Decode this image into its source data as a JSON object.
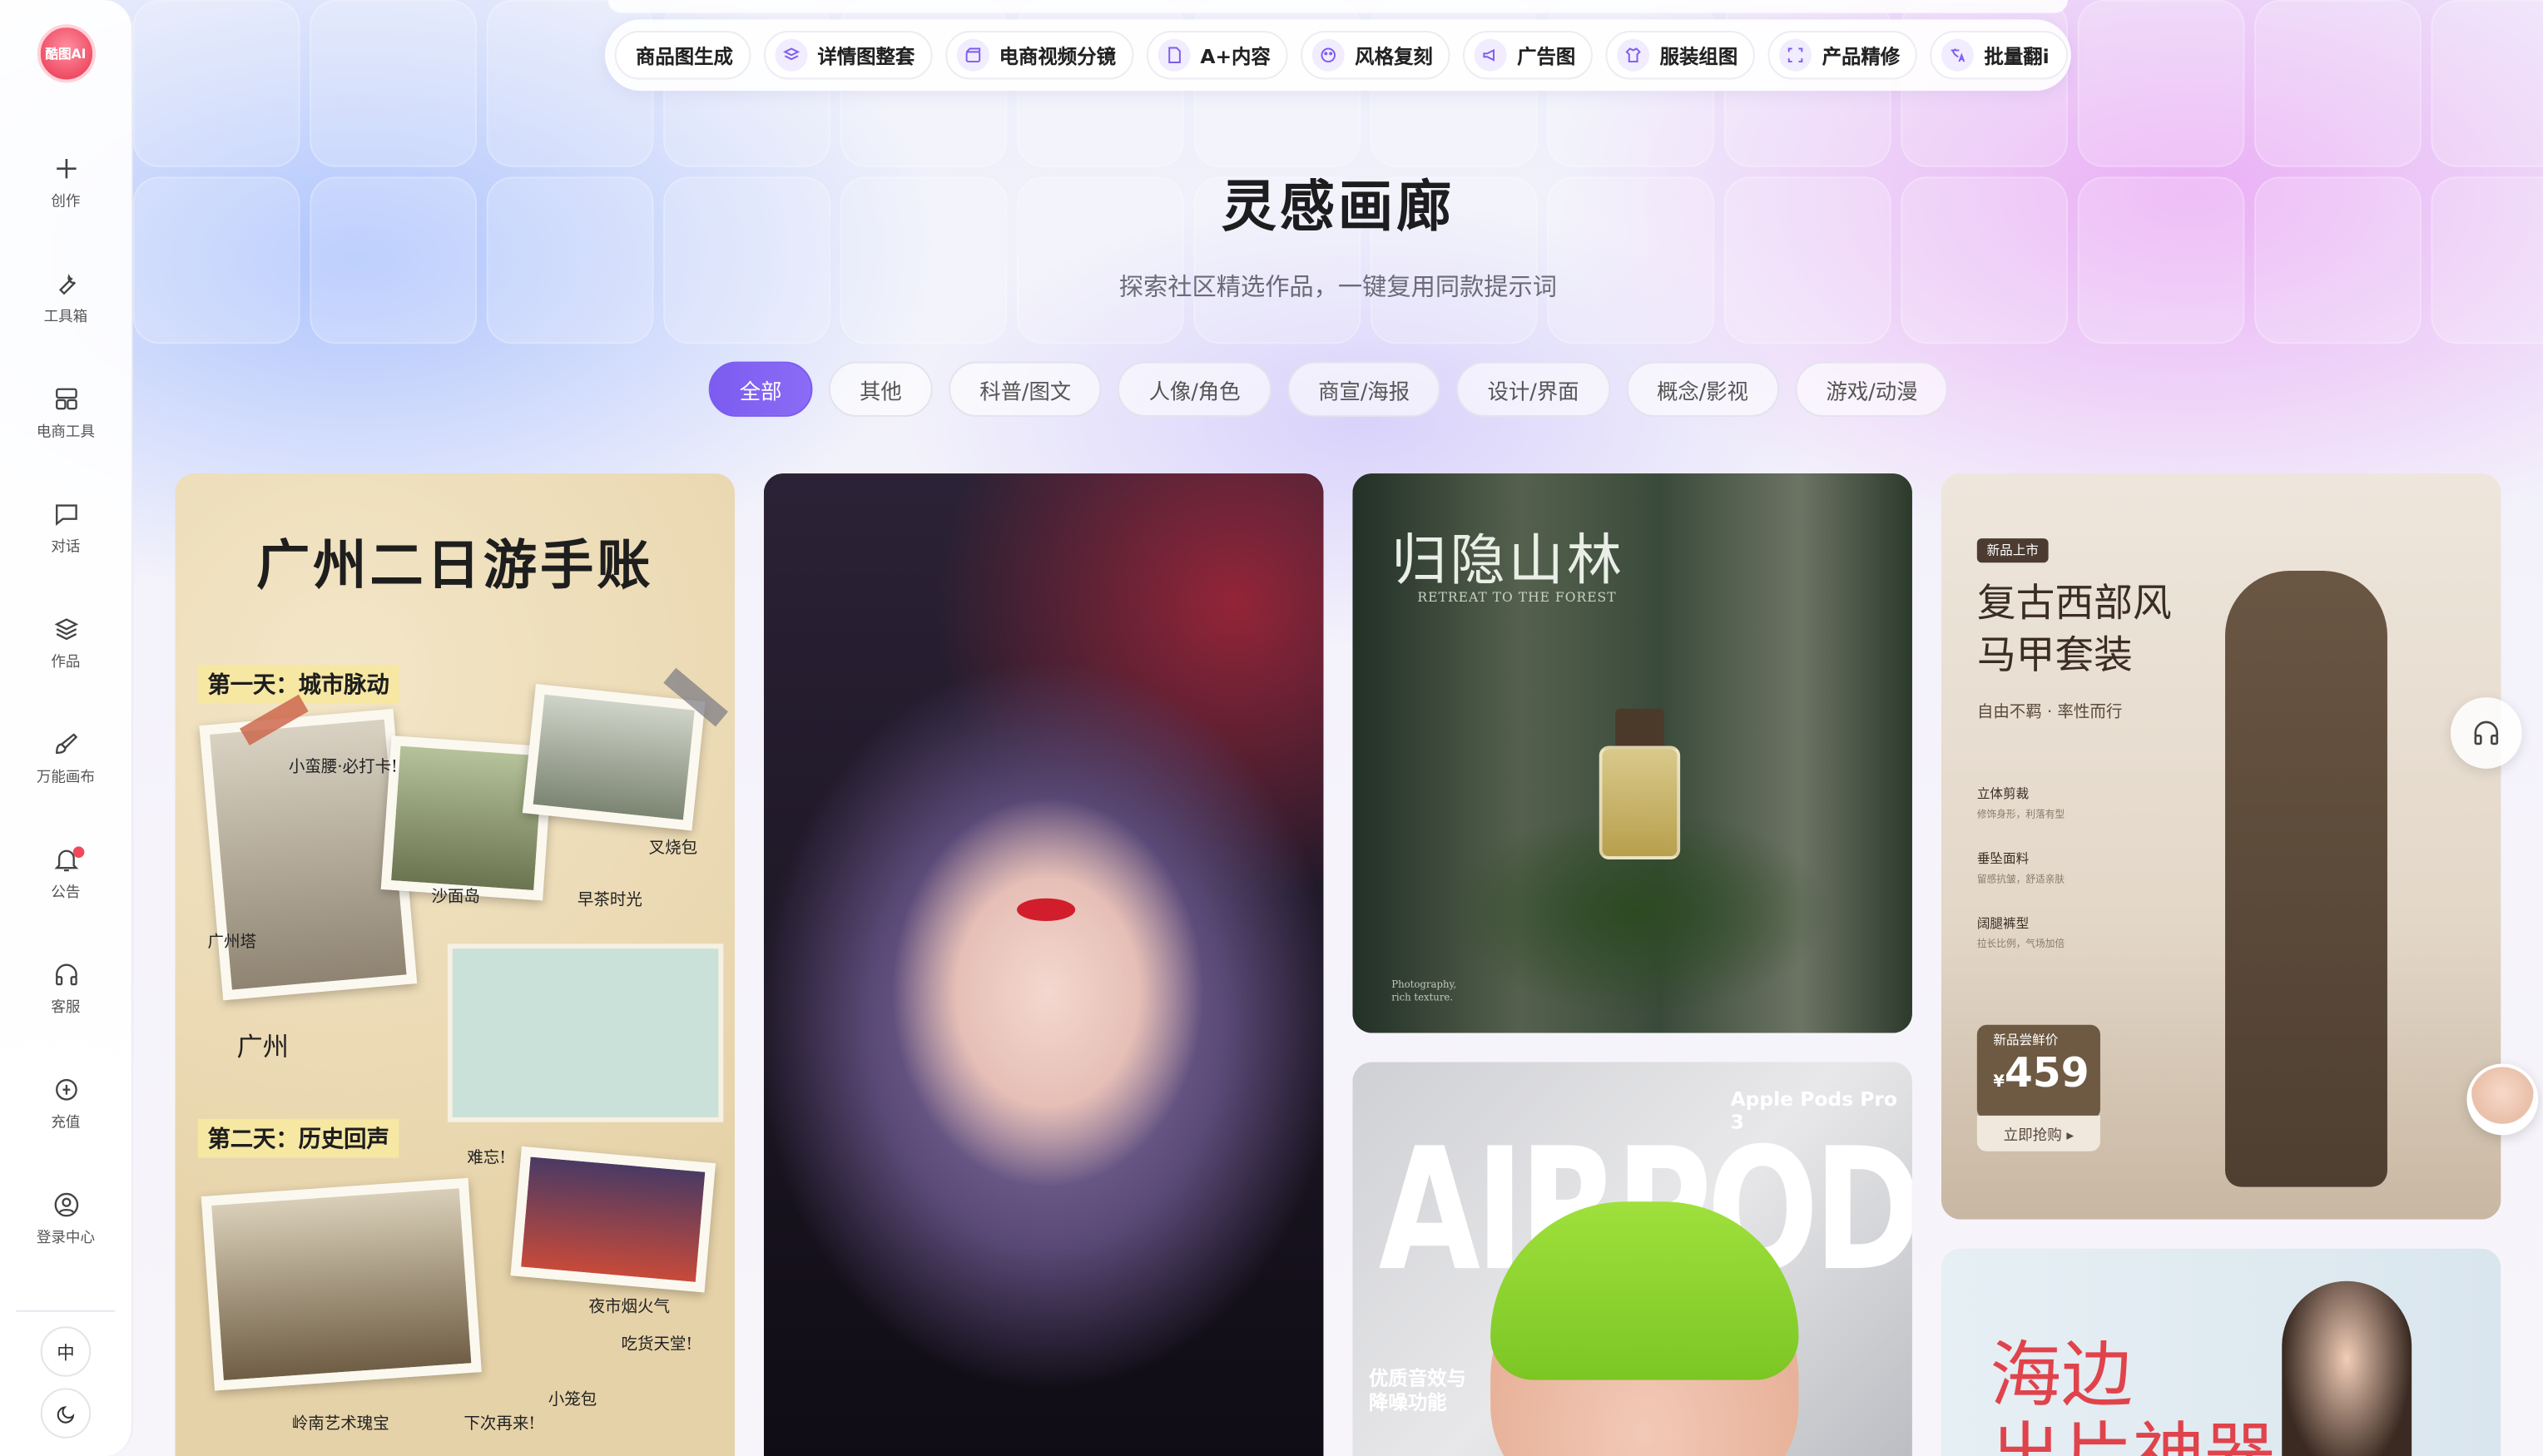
{
  "app": {
    "logo_text": "酷图AI"
  },
  "sidebar": {
    "items": [
      {
        "label": "创作",
        "icon": "plus-icon"
      },
      {
        "label": "工具箱",
        "icon": "wrench-icon"
      },
      {
        "label": "电商工具",
        "icon": "grid-icon"
      },
      {
        "label": "对话",
        "icon": "chat-icon"
      },
      {
        "label": "作品",
        "icon": "layers-icon"
      },
      {
        "label": "万能画布",
        "icon": "brush-icon"
      },
      {
        "label": "公告",
        "icon": "bell-icon",
        "has_notification_dot": true
      },
      {
        "label": "客服",
        "icon": "headset-icon"
      },
      {
        "label": "充值",
        "icon": "coin-icon"
      },
      {
        "label": "登录中心",
        "icon": "user-icon"
      }
    ],
    "language_label": "中",
    "theme_icon": "moon-icon"
  },
  "toolbar": {
    "items": [
      {
        "label": "商品图生成",
        "icon": "image-icon"
      },
      {
        "label": "详情图整套",
        "icon": "layers-icon"
      },
      {
        "label": "电商视频分镜",
        "icon": "clapper-icon"
      },
      {
        "label": "A+内容",
        "icon": "document-icon"
      },
      {
        "label": "风格复刻",
        "icon": "palette-icon"
      },
      {
        "label": "广告图",
        "icon": "megaphone-icon"
      },
      {
        "label": "服装组图",
        "icon": "shirt-icon"
      },
      {
        "label": "产品精修",
        "icon": "crop-icon"
      },
      {
        "label": "批量翻i",
        "icon": "translate-icon"
      }
    ]
  },
  "hero": {
    "title": "灵感画廊",
    "subtitle": "探索社区精选作品，一键复用同款提示词"
  },
  "filters": {
    "items": [
      "全部",
      "其他",
      "科普/图文",
      "人像/角色",
      "商宣/海报",
      "设计/界面",
      "概念/影视",
      "游戏/动漫"
    ],
    "active_index": 0
  },
  "gallery": {
    "card1": {
      "title": "广州二日游手账",
      "day1": "第一天：城市脉动",
      "day2": "第二天：历史回声",
      "labels": [
        "小蛮腰·必打卡!",
        "沙面岛",
        "早茶时光",
        "广州塔",
        "叉烧包",
        "广州",
        "夜市烟火气",
        "吃货天堂!",
        "难忘!",
        "小笼包",
        "岭南艺术瑰宝",
        "下次再来!"
      ]
    },
    "card3": {
      "title": "归隐山林",
      "subtitle": "RETREAT TO THE FOREST",
      "footnote_1": "Photography,",
      "footnote_2": "rich texture."
    },
    "card4": {
      "headline": "Apple Pods Pro 3",
      "big_text": "AIRPODS",
      "feature_1": "优质音效与",
      "feature_2": "降噪功能"
    },
    "card5": {
      "tag": "新品上市",
      "title_line1": "复古西部风",
      "title_line2": "马甲套装",
      "slogan": "自由不羁 · 率性而行",
      "features": [
        {
          "name": "立体剪裁",
          "desc": "修饰身形，利落有型"
        },
        {
          "name": "垂坠面料",
          "desc": "留感抗皱，舒适亲肤"
        },
        {
          "name": "阔腿裤型",
          "desc": "拉长比例，气场加倍"
        }
      ],
      "price_label": "新品尝鲜价",
      "currency": "¥",
      "price": "459",
      "cta": "立即抢购 ▸"
    },
    "card6": {
      "title_line1": "海边",
      "title_line2": "出片神器"
    }
  }
}
